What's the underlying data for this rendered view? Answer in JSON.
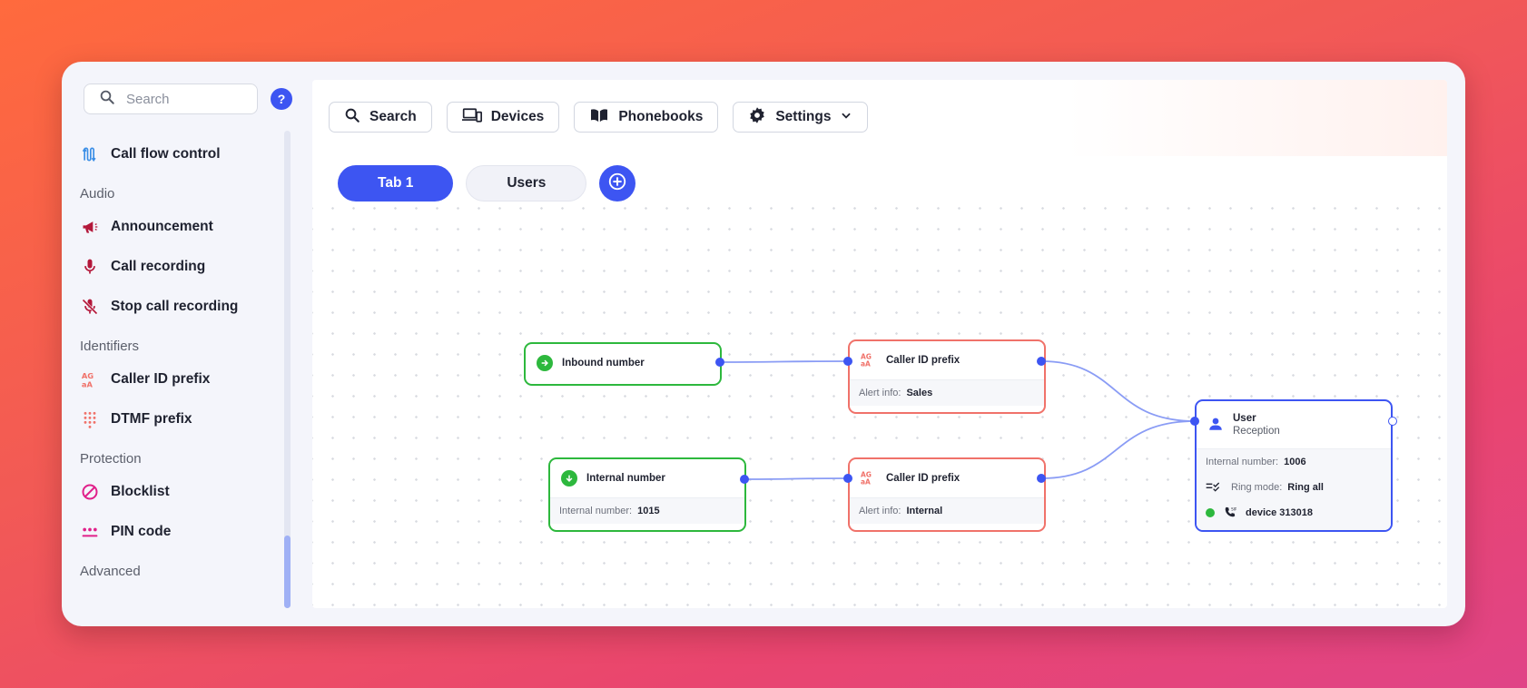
{
  "sidebar": {
    "search_placeholder": "Search",
    "help_label": "?",
    "items": [
      {
        "type": "item",
        "label": "Call flow control",
        "icon": "flow-icon",
        "color": "#3a8ee6"
      },
      {
        "type": "category",
        "label": "Audio"
      },
      {
        "type": "item",
        "label": "Announcement",
        "icon": "megaphone-icon",
        "color": "#b3173a"
      },
      {
        "type": "item",
        "label": "Call recording",
        "icon": "microphone-icon",
        "color": "#b3173a"
      },
      {
        "type": "item",
        "label": "Stop call recording",
        "icon": "microphone-off-icon",
        "color": "#b3173a"
      },
      {
        "type": "category",
        "label": "Identifiers"
      },
      {
        "type": "item",
        "label": "Caller ID prefix",
        "icon": "caller-id-icon",
        "color": "#f0726a"
      },
      {
        "type": "item",
        "label": "DTMF prefix",
        "icon": "dialpad-icon",
        "color": "#f0726a"
      },
      {
        "type": "category",
        "label": "Protection"
      },
      {
        "type": "item",
        "label": "Blocklist",
        "icon": "block-icon",
        "color": "#e0208a"
      },
      {
        "type": "item",
        "label": "PIN code",
        "icon": "pin-icon",
        "color": "#e0208a"
      },
      {
        "type": "category",
        "label": "Advanced"
      }
    ]
  },
  "toolbar": {
    "search_label": "Search",
    "devices_label": "Devices",
    "phonebooks_label": "Phonebooks",
    "settings_label": "Settings"
  },
  "tabs": {
    "active_label": "Tab 1",
    "second_label": "Users"
  },
  "nodes": {
    "inbound": {
      "title": "Inbound number"
    },
    "internal": {
      "title": "Internal number",
      "field_label": "Internal number:",
      "field_value": "1015"
    },
    "caller_sales": {
      "title": "Caller ID prefix",
      "field_label": "Alert info:",
      "field_value": "Sales"
    },
    "caller_internal": {
      "title": "Caller ID prefix",
      "field_label": "Alert info:",
      "field_value": "Internal"
    },
    "user": {
      "title": "User",
      "subtitle": "Reception",
      "internal_label": "Internal number:",
      "internal_value": "1006",
      "ring_label": "Ring mode:",
      "ring_value": "Ring all",
      "device_label": "device 313018",
      "device_status_color": "#2db83d"
    }
  },
  "colors": {
    "accent": "#3d55f2",
    "entry_green": "#2db83d",
    "identifier_red": "#f0726a",
    "edge": "#8a9cf5"
  }
}
